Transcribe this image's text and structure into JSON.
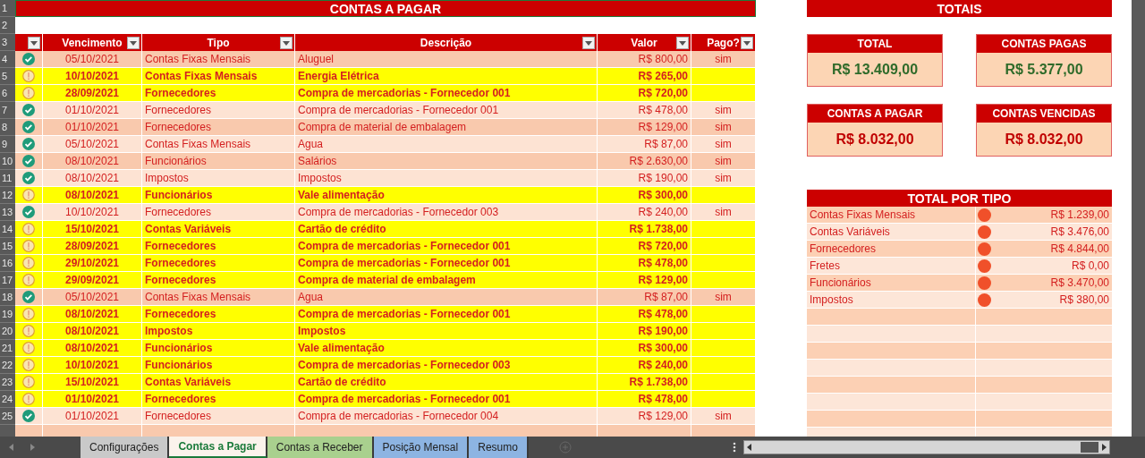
{
  "sheet_title": "CONTAS A PAGAR",
  "row_numbers": [
    "1",
    "2",
    "3",
    "4",
    "5",
    "6",
    "7",
    "8",
    "9",
    "10",
    "11",
    "12",
    "13",
    "14",
    "15",
    "16",
    "17",
    "18",
    "19",
    "20",
    "21",
    "22",
    "23",
    "24",
    "25"
  ],
  "columns": [
    {},
    {
      "label": "Vencimento"
    },
    {
      "label": "Tipo"
    },
    {
      "label": "Descrição"
    },
    {
      "label": "Valor"
    },
    {
      "label": "Pago?"
    }
  ],
  "rows": [
    {
      "paid": true,
      "date": "05/10/2021",
      "tipo": "Contas Fixas Mensais",
      "descricao": "Aluguel",
      "valor": "R$ 800,00",
      "pago": "sim"
    },
    {
      "paid": false,
      "date": "10/10/2021",
      "tipo": "Contas Fixas Mensais",
      "descricao": "Energia Elétrica",
      "valor": "R$ 265,00"
    },
    {
      "paid": false,
      "date": "28/09/2021",
      "tipo": "Fornecedores",
      "descricao": "Compra de mercadorias - Fornecedor 001",
      "valor": "R$ 720,00"
    },
    {
      "paid": true,
      "date": "01/10/2021",
      "tipo": "Fornecedores",
      "descricao": "Compra de mercadorias - Fornecedor 001",
      "valor": "R$ 478,00",
      "pago": "sim"
    },
    {
      "paid": true,
      "date": "01/10/2021",
      "tipo": "Fornecedores",
      "descricao": "Compra de material de embalagem",
      "valor": "R$ 129,00",
      "pago": "sim"
    },
    {
      "paid": true,
      "date": "05/10/2021",
      "tipo": "Contas Fixas Mensais",
      "descricao": "Agua",
      "valor": "R$ 87,00",
      "pago": "sim"
    },
    {
      "paid": true,
      "date": "08/10/2021",
      "tipo": "Funcionários",
      "descricao": "Salários",
      "valor": "R$ 2.630,00",
      "pago": "sim"
    },
    {
      "paid": true,
      "date": "08/10/2021",
      "tipo": "Impostos",
      "descricao": "Impostos",
      "valor": "R$ 190,00",
      "pago": "sim"
    },
    {
      "paid": false,
      "date": "08/10/2021",
      "tipo": "Funcionários",
      "descricao": "Vale alimentação",
      "valor": "R$ 300,00"
    },
    {
      "paid": true,
      "date": "10/10/2021",
      "tipo": "Fornecedores",
      "descricao": "Compra de mercadorias - Fornecedor 003",
      "valor": "R$ 240,00",
      "pago": "sim"
    },
    {
      "paid": false,
      "date": "15/10/2021",
      "tipo": "Contas Variáveis",
      "descricao": "Cartão de crédito",
      "valor": "R$ 1.738,00"
    },
    {
      "paid": false,
      "date": "28/09/2021",
      "tipo": "Fornecedores",
      "descricao": "Compra de mercadorias - Fornecedor 001",
      "valor": "R$ 720,00"
    },
    {
      "paid": false,
      "date": "29/10/2021",
      "tipo": "Fornecedores",
      "descricao": "Compra de mercadorias - Fornecedor 001",
      "valor": "R$ 478,00"
    },
    {
      "paid": false,
      "date": "29/09/2021",
      "tipo": "Fornecedores",
      "descricao": "Compra de material de embalagem",
      "valor": "R$ 129,00"
    },
    {
      "paid": true,
      "date": "05/10/2021",
      "tipo": "Contas Fixas Mensais",
      "descricao": "Agua",
      "valor": "R$ 87,00",
      "pago": "sim"
    },
    {
      "paid": false,
      "date": "08/10/2021",
      "tipo": "Fornecedores",
      "descricao": "Compra de mercadorias - Fornecedor 001",
      "valor": "R$ 478,00"
    },
    {
      "paid": false,
      "date": "08/10/2021",
      "tipo": "Impostos",
      "descricao": "Impostos",
      "valor": "R$ 190,00"
    },
    {
      "paid": false,
      "date": "08/10/2021",
      "tipo": "Funcionários",
      "descricao": "Vale alimentação",
      "valor": "R$ 300,00"
    },
    {
      "paid": false,
      "date": "10/10/2021",
      "tipo": "Funcionários",
      "descricao": "Compra de mercadorias - Fornecedor 003",
      "valor": "R$ 240,00"
    },
    {
      "paid": false,
      "date": "15/10/2021",
      "tipo": "Contas Variáveis",
      "descricao": "Cartão de crédito",
      "valor": "R$ 1.738,00"
    },
    {
      "paid": false,
      "date": "01/10/2021",
      "tipo": "Fornecedores",
      "descricao": "Compra de mercadorias - Fornecedor 001",
      "valor": "R$ 478,00"
    },
    {
      "paid": true,
      "date": "01/10/2021",
      "tipo": "Fornecedores",
      "descricao": "Compra de mercadorias - Fornecedor 004",
      "valor": "R$ 129,00",
      "pago": "sim"
    }
  ],
  "totals": {
    "title": "TOTAIS",
    "cards": [
      {
        "label": "TOTAL",
        "value": "R$ 13.409,00",
        "color": "#2f6b2a"
      },
      {
        "label": "CONTAS PAGAS",
        "value": "R$ 5.377,00",
        "color": "#2f6b2a"
      },
      {
        "label": "CONTAS A PAGAR",
        "value": "R$ 8.032,00",
        "color": "#c00000"
      },
      {
        "label": "CONTAS VENCIDAS",
        "value": "R$ 8.032,00",
        "color": "#c00000"
      }
    ]
  },
  "total_por_tipo": {
    "title": "TOTAL POR TIPO",
    "items": [
      {
        "tipo": "Contas Fixas Mensais",
        "valor": "R$ 1.239,00",
        "color": "#f0502a"
      },
      {
        "tipo": "Contas Variáveis",
        "valor": "R$ 3.476,00",
        "color": "#f0502a"
      },
      {
        "tipo": "Fornecedores",
        "valor": "R$ 4.844,00",
        "color": "#f0502a"
      },
      {
        "tipo": "Fretes",
        "valor": "R$ 0,00",
        "color": "#f0502a"
      },
      {
        "tipo": "Funcionários",
        "valor": "R$ 3.470,00",
        "color": "#f0502a"
      },
      {
        "tipo": "Impostos",
        "valor": "R$ 380,00",
        "color": "#f0502a"
      }
    ]
  },
  "sheet_tabs": [
    {
      "label": "Configurações",
      "selected": false,
      "color": "#c9c9c9"
    },
    {
      "label": "Contas a Pagar",
      "selected": true,
      "color": "#fbf3ec"
    },
    {
      "label": "Contas a Receber",
      "selected": false,
      "color": "#a9d08e"
    },
    {
      "label": "Posição Mensal",
      "selected": false,
      "color": "#8db4e2"
    },
    {
      "label": "Resumo",
      "selected": false,
      "color": "#8db4e2"
    }
  ]
}
